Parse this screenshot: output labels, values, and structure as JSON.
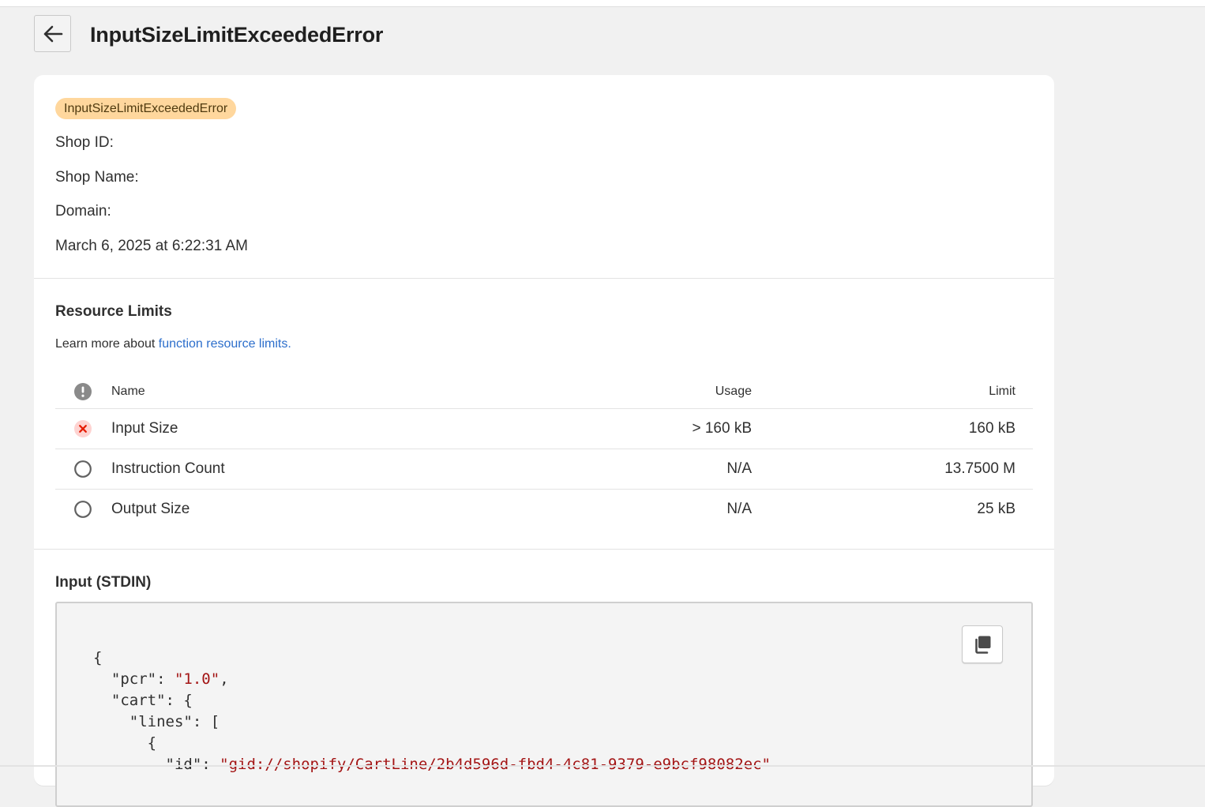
{
  "header": {
    "title": "InputSizeLimitExceededError",
    "back_label": "Back"
  },
  "info": {
    "badge": "InputSizeLimitExceededError",
    "shop_id_label": "Shop ID:",
    "shop_name_label": "Shop Name:",
    "domain_label": "Domain:",
    "timestamp": "March 6, 2025 at 6:22:31 AM"
  },
  "limits": {
    "heading": "Resource Limits",
    "learn_more_prefix": "Learn more about ",
    "learn_more_link": "function resource limits.",
    "columns": {
      "name": "Name",
      "usage": "Usage",
      "limit": "Limit"
    },
    "rows": [
      {
        "name": "Input Size",
        "usage": "> 160 kB",
        "limit": "160 kB",
        "status": "exceeded"
      },
      {
        "name": "Instruction Count",
        "usage": "N/A",
        "limit": "13.7500 M",
        "status": "none"
      },
      {
        "name": "Output Size",
        "usage": "N/A",
        "limit": "25 kB",
        "status": "none"
      }
    ]
  },
  "input": {
    "heading": "Input (STDIN)",
    "copy_icon": "copy-icon",
    "code": {
      "l1": "{",
      "l2_key": "\"pcr\"",
      "l2_val": "\"1.0\"",
      "l3_key": "\"cart\"",
      "l3_rest": ": {",
      "l4_key": "\"lines\"",
      "l4_rest": ": [",
      "l5": "{",
      "l6_key": "\"id\"",
      "l6_val": "\"gid://shopify/CartLine/2b4d596d-fbd4-4c81-9379-e9bcf98082ec\""
    }
  },
  "colors": {
    "badge_bg": "#ffd79d",
    "link": "#2c6ecb",
    "error": "#e51c00",
    "string": "#a31515"
  }
}
